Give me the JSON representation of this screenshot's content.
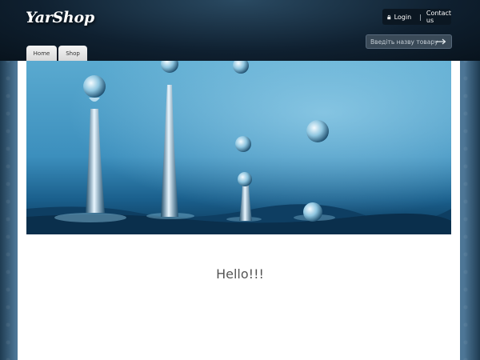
{
  "brand": {
    "name": "YarShop"
  },
  "topnav": {
    "login": "Login",
    "separator": "|",
    "contact": "Contact us"
  },
  "search": {
    "placeholder": "Введіть назву товару"
  },
  "tabs": [
    {
      "label": "Home"
    },
    {
      "label": "Shop"
    }
  ],
  "hero": {
    "subject": "water-droplets-photo"
  },
  "main": {
    "greeting": "Hello!!!"
  },
  "colors": {
    "header": "#0f2030",
    "page": "#ffffff",
    "side": "#4d7696"
  },
  "icons": {
    "lock": "lock-icon",
    "arrow": "arrow-right-icon"
  }
}
